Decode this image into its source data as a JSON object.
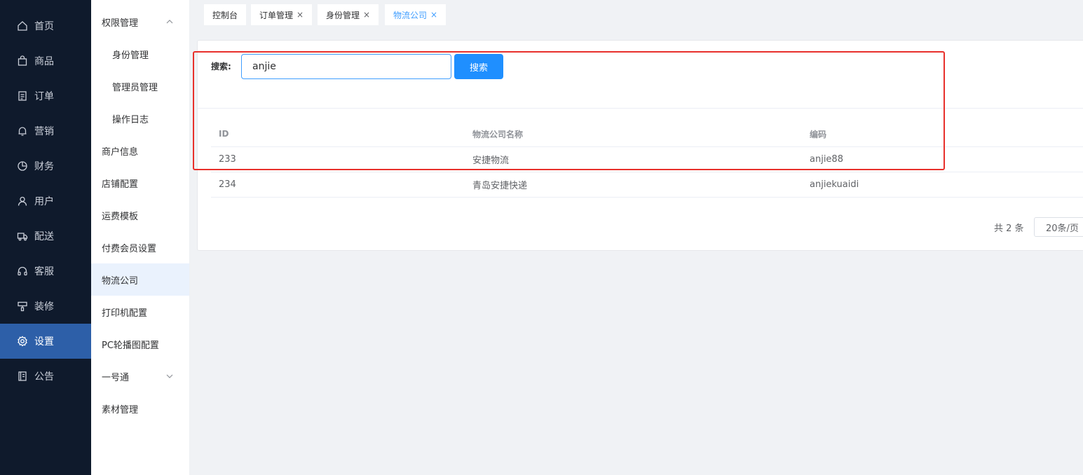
{
  "nav": {
    "items": [
      {
        "label": "首页",
        "icon": "home-icon"
      },
      {
        "label": "商品",
        "icon": "bag-icon"
      },
      {
        "label": "订单",
        "icon": "document-icon"
      },
      {
        "label": "营销",
        "icon": "bell-icon"
      },
      {
        "label": "财务",
        "icon": "pie-chart-icon"
      },
      {
        "label": "用户",
        "icon": "user-icon"
      },
      {
        "label": "配送",
        "icon": "truck-icon"
      },
      {
        "label": "客服",
        "icon": "headset-icon"
      },
      {
        "label": "装修",
        "icon": "brush-icon"
      },
      {
        "label": "设置",
        "icon": "gear-icon",
        "active": true
      },
      {
        "label": "公告",
        "icon": "notice-icon"
      }
    ]
  },
  "submenu": {
    "items": [
      {
        "label": "权限管理",
        "expanded": true
      },
      {
        "label": "身份管理"
      },
      {
        "label": "管理员管理"
      },
      {
        "label": "操作日志"
      },
      {
        "label": "商户信息"
      },
      {
        "label": "店铺配置"
      },
      {
        "label": "运费模板"
      },
      {
        "label": "付费会员设置"
      },
      {
        "label": "物流公司",
        "active": true
      },
      {
        "label": "打印机配置"
      },
      {
        "label": "PC轮播图配置"
      },
      {
        "label": "一号通",
        "expanded": false
      },
      {
        "label": "素材管理"
      }
    ]
  },
  "tabs": [
    {
      "label": "控制台",
      "closable": false
    },
    {
      "label": "订单管理",
      "closable": true
    },
    {
      "label": "身份管理",
      "closable": true
    },
    {
      "label": "物流公司",
      "closable": true,
      "active": true
    }
  ],
  "tab_close_glyph": "×",
  "search": {
    "label": "搜索:",
    "value": "anjie",
    "button_label": "搜索"
  },
  "table": {
    "headers": [
      "ID",
      "物流公司名称",
      "编码"
    ],
    "rows": [
      [
        "233",
        "安捷物流",
        "anjie88"
      ],
      [
        "234",
        "青岛安捷快递",
        "anjiekuaidi"
      ]
    ]
  },
  "pagination": {
    "total_text": "共 2 条",
    "page_size_text": "20条/页"
  },
  "colors": {
    "nav_bg": "#0f1a2c",
    "nav_active": "#2d5fa8",
    "accent": "#409eff",
    "annotation": "#e8302b"
  }
}
